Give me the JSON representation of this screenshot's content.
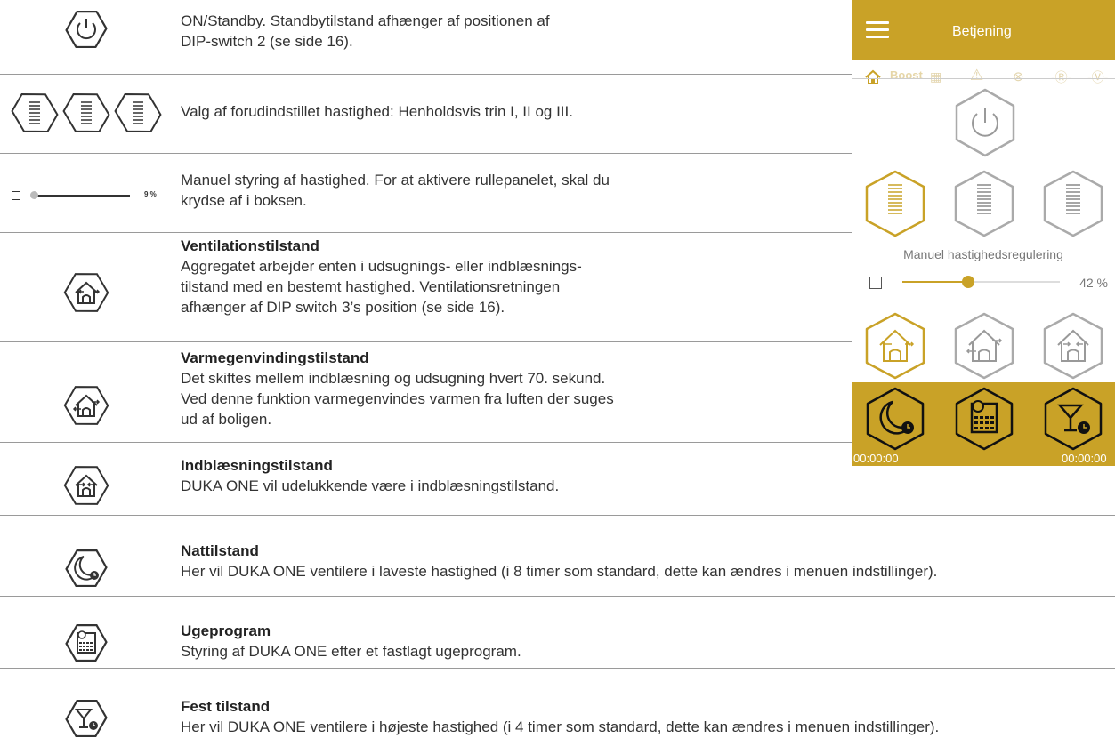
{
  "rows": [
    {
      "id": "standby",
      "title": "",
      "text": [
        "ON/Standby. Standbytilstand afhænger af positionen af",
        "DIP-switch 2 (se side 16)."
      ]
    },
    {
      "id": "speeds",
      "title": "",
      "text": [
        "Valg af forudindstillet hastighed: Henholdsvis trin I, II og III."
      ]
    },
    {
      "id": "manual",
      "title": "",
      "text": [
        "Manuel styring af hastighed. For at aktivere rullepanelet, skal du",
        "krydse af i boksen."
      ],
      "slider_value": "9 %"
    },
    {
      "id": "ventilation",
      "title": "Ventilationstilstand",
      "text": [
        "Aggregatet arbejder enten i udsugnings- eller indblæsnings-",
        "tilstand  med en bestemt hastighed. Ventilationsretningen",
        "afhænger af DIP switch 3’s position (se side 16)."
      ]
    },
    {
      "id": "heatrecovery",
      "title": "Varmegenvindingstilstand",
      "text": [
        "Det skiftes mellem indblæsning og udsugning hvert 70. sekund.",
        "Ved denne funktion varmegenvindes varmen fra luften der suges",
        "ud af  boligen."
      ]
    },
    {
      "id": "supply",
      "title": "Indblæsningstilstand",
      "text": [
        "DUKA ONE vil udelukkende være i indblæsningstilstand."
      ]
    },
    {
      "id": "night",
      "title": "Nattilstand",
      "text": [
        "Her vil DUKA ONE ventilere i laveste hastighed (i 8 timer som standard, dette kan ændres i menuen indstillinger)."
      ]
    },
    {
      "id": "week",
      "title": "Ugeprogram",
      "text": [
        "Styring af DUKA ONE efter et fastlagt ugeprogram."
      ]
    },
    {
      "id": "party",
      "title": "Fest tilstand",
      "text": [
        "Her vil DUKA ONE ventilere i højeste hastighed (i 4 timer som standard, dette kan ændres i menuen indstillinger)."
      ]
    }
  ],
  "phone": {
    "title": "Betjening",
    "boost_label": "Boost",
    "manual_label": "Manuel hastighedsregulering",
    "manual_value_percent": "42 %",
    "manual_level": 0.42,
    "timer_left": "00:00:00",
    "timer_right": "00:00:00",
    "status_icons": [
      "home-icon",
      "fan-icon",
      "warning-icon",
      "filter-icon",
      "r-icon",
      "v-icon"
    ]
  },
  "colors": {
    "accent": "#c9a227",
    "grey": "#9a9a9a",
    "text": "#333333"
  }
}
